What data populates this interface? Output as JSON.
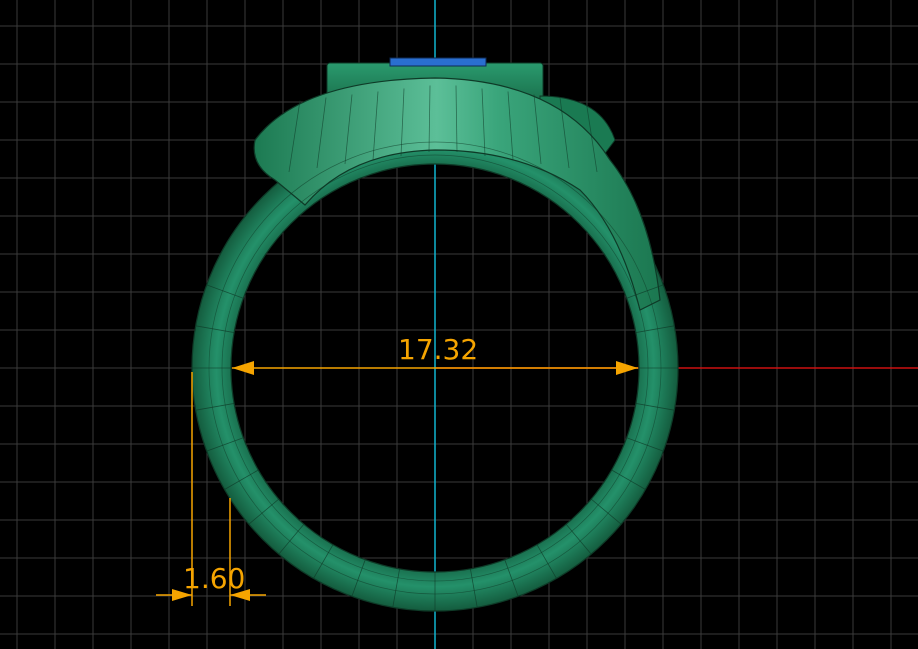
{
  "viewport": {
    "background_color": "#000000",
    "grid_color": "#3a3a3a",
    "axis_x_color": "#cc1111",
    "axis_y_color": "#10b5cf"
  },
  "model": {
    "type": "ring",
    "body_color": "#1f8a5e",
    "highlight_color": "#6cc7a4",
    "outline_color": "#0e3a27",
    "gem_color": "#2a6fd0"
  },
  "dimensions": {
    "color": "#f5a400",
    "inner_diameter": {
      "label": "17.32"
    },
    "band_thickness": {
      "label": "1.60"
    }
  }
}
